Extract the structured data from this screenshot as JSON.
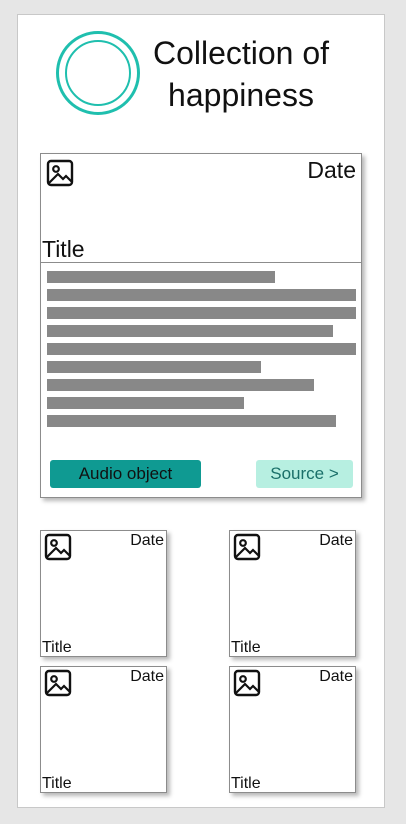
{
  "header": {
    "logo_icon": "circle-logo-icon",
    "title": "Collection of happiness"
  },
  "featured": {
    "image_icon": "image-icon",
    "date": "Date",
    "title": "Title",
    "audio_button": "Audio object",
    "source_link": "Source >"
  },
  "grid": [
    {
      "image_icon": "image-icon",
      "date": "Date",
      "title": "Title"
    },
    {
      "image_icon": "image-icon",
      "date": "Date",
      "title": "Title"
    },
    {
      "image_icon": "image-icon",
      "date": "Date",
      "title": "Title"
    },
    {
      "image_icon": "image-icon",
      "date": "Date",
      "title": "Title"
    }
  ],
  "colors": {
    "accent": "#1fbfae",
    "button": "#0f9a92",
    "source_button": "#b7efe1",
    "placeholder_text": "#888888"
  }
}
